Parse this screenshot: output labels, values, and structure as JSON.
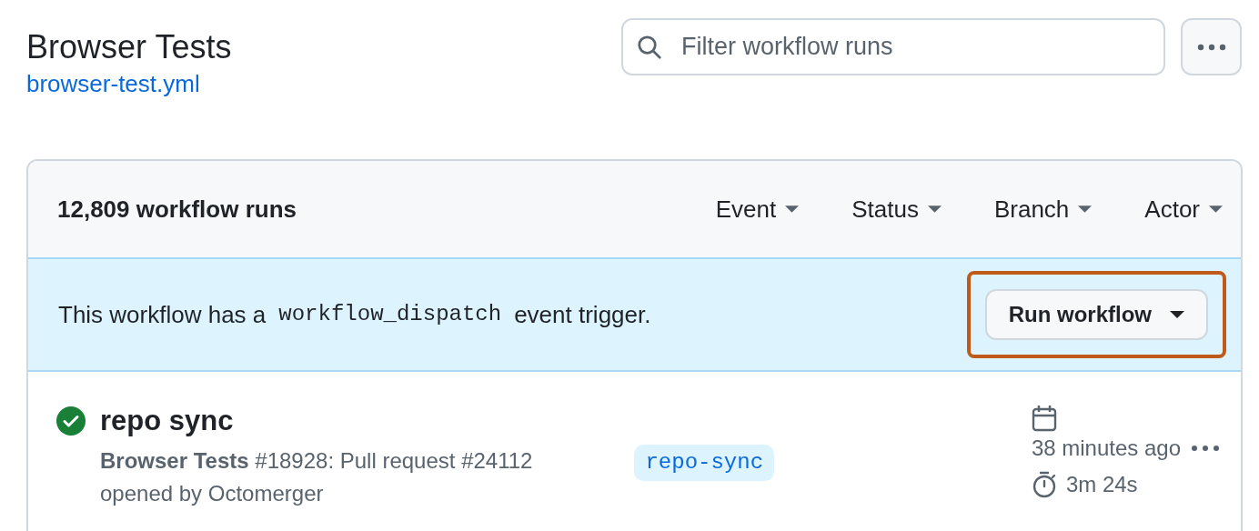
{
  "header": {
    "title": "Browser Tests",
    "file_link": "browser-test.yml"
  },
  "search": {
    "placeholder": "Filter workflow runs"
  },
  "runs_box": {
    "count": "12,809 workflow runs",
    "filters": [
      {
        "label": "Event"
      },
      {
        "label": "Status"
      },
      {
        "label": "Branch"
      },
      {
        "label": "Actor"
      }
    ],
    "banner": {
      "text_before": "This workflow has a",
      "code": "workflow_dispatch",
      "text_after": "event trigger.",
      "button": {
        "label": "Run workflow",
        "highlighted": true
      }
    },
    "runs": [
      {
        "kind": "success",
        "title": "repo sync",
        "workflow": "Browser Tests",
        "detail": "#18928: Pull request #24112",
        "opened_by": "opened by Octomerger",
        "branch": "repo-sync",
        "time": "38 minutes ago",
        "duration": "3m 24s"
      }
    ]
  }
}
